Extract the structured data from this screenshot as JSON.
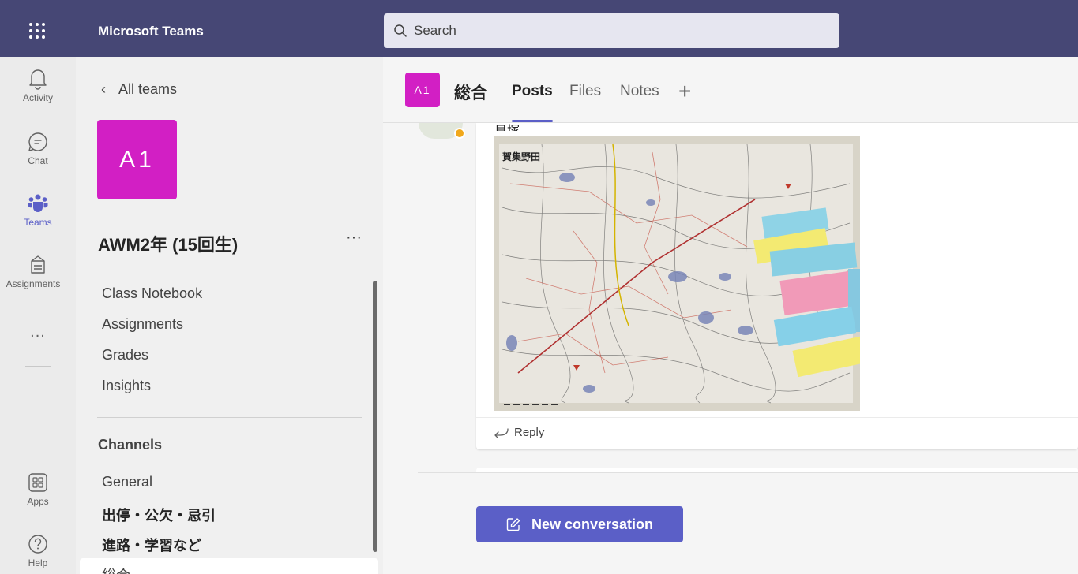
{
  "app": {
    "name": "Microsoft Teams",
    "search_placeholder": "Search",
    "brand_color": "#464775",
    "accent_color": "#5b5fc7"
  },
  "rail": {
    "items": [
      {
        "label": "Activity",
        "icon": "bell-icon"
      },
      {
        "label": "Chat",
        "icon": "chat-icon"
      },
      {
        "label": "Teams",
        "icon": "teams-icon",
        "active": true
      },
      {
        "label": "Assignments",
        "icon": "assignments-icon"
      },
      {
        "label": "Apps",
        "icon": "apps-icon"
      },
      {
        "label": "Help",
        "icon": "help-icon"
      }
    ],
    "more_label": "..."
  },
  "panel": {
    "back_label": "All teams",
    "team_initials": "A1",
    "team_color": "#d21fc4",
    "team_name": "AWM2年 (15回生)",
    "more_label": "···",
    "links": [
      "Class Notebook",
      "Assignments",
      "Grades",
      "Insights"
    ],
    "channels_heading": "Channels",
    "channels": [
      {
        "label": "General",
        "bold": false
      },
      {
        "label": "出停・公欠・忌引",
        "bold": true
      },
      {
        "label": "進路・学習など",
        "bold": true
      },
      {
        "label": "総合",
        "bold": false,
        "active": true
      }
    ]
  },
  "channel": {
    "avatar": "A1",
    "title": "総合",
    "tabs": [
      {
        "label": "Posts",
        "active": true
      },
      {
        "label": "Files",
        "active": false
      },
      {
        "label": "Notes",
        "active": false
      }
    ],
    "add_tab": "+"
  },
  "post": {
    "text": "貝塚",
    "image_alt": "topographic map with sticky notes",
    "map_title": "賀集野田",
    "presence_color": "#f1a81b",
    "reply_label": "Reply"
  },
  "new_conversation_label": "New conversation"
}
